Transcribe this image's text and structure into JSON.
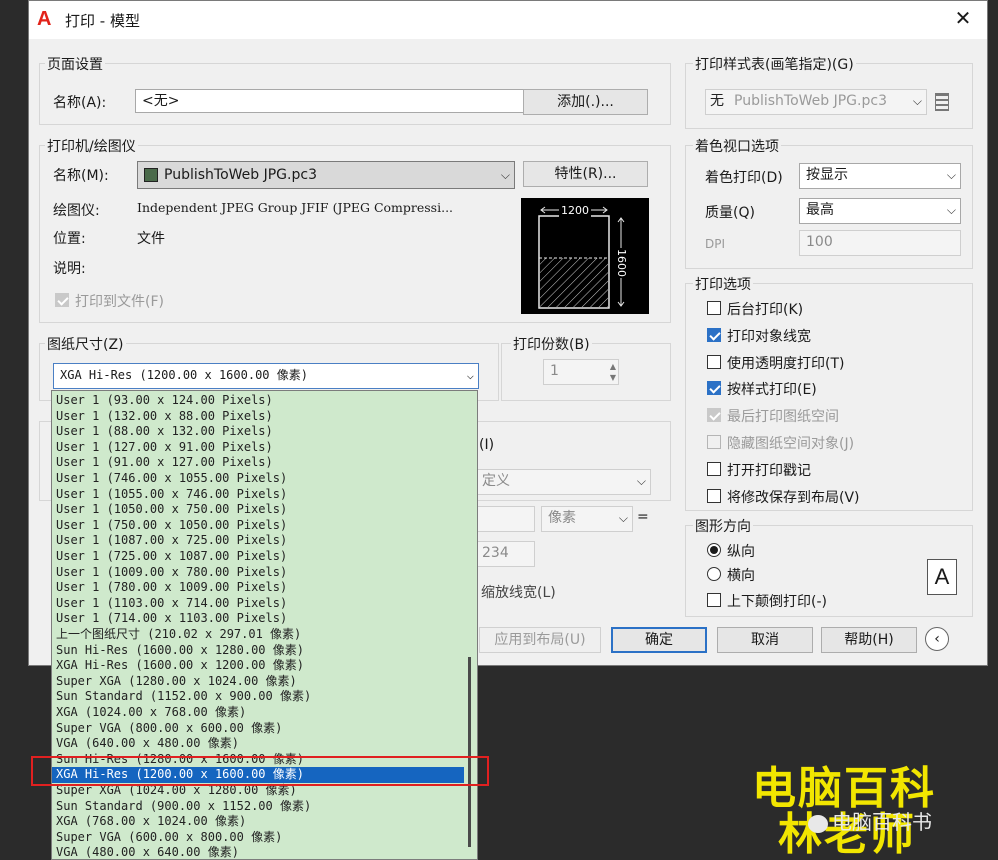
{
  "window": {
    "title": "打印 - 模型",
    "close": "✕"
  },
  "page_setup": {
    "legend": "页面设置",
    "name_label": "名称(A):",
    "name_value": "<无>",
    "add_button": "添加(.)..."
  },
  "printer": {
    "legend": "打印机/绘图仪",
    "name_label": "名称(M):",
    "name_value": "PublishToWeb JPG.pc3",
    "props_button": "特性(R)...",
    "plotter_label": "绘图仪:",
    "plotter_value": "Independent JPEG Group JFIF (JPEG Compressi...",
    "location_label": "位置:",
    "location_value": "文件",
    "desc_label": "说明:",
    "plot_to_file": "打印到文件(F)",
    "preview_width": "1200",
    "preview_height": "1600"
  },
  "paper_size": {
    "legend": "图纸尺寸(Z)",
    "selected": "XGA Hi-Res (1200.00 x 1600.00 像素)",
    "options": [
      "User 1 (93.00 x 124.00 Pixels)",
      "User 1 (132.00 x 88.00 Pixels)",
      "User 1 (88.00 x 132.00 Pixels)",
      "User 1 (127.00 x 91.00 Pixels)",
      "User 1 (91.00 x 127.00 Pixels)",
      "User 1 (746.00 x 1055.00 Pixels)",
      "User 1 (1055.00 x 746.00 Pixels)",
      "User 1 (1050.00 x 750.00 Pixels)",
      "User 1 (750.00 x 1050.00 Pixels)",
      "User 1 (1087.00 x 725.00 Pixels)",
      "User 1 (725.00 x 1087.00 Pixels)",
      "User 1 (1009.00 x 780.00 Pixels)",
      "User 1 (780.00 x 1009.00 Pixels)",
      "User 1 (1103.00 x 714.00 Pixels)",
      "User 1 (714.00 x 1103.00 Pixels)",
      "上一个图纸尺寸 (210.02 x 297.01 像素)",
      "Sun Hi-Res (1600.00 x 1280.00 像素)",
      "XGA Hi-Res (1600.00 x 1200.00 像素)",
      "Super XGA (1280.00 x 1024.00 像素)",
      "Sun Standard (1152.00 x 900.00 像素)",
      "XGA (1024.00 x 768.00 像素)",
      "Super VGA (800.00 x 600.00 像素)",
      "VGA (640.00 x 480.00 像素)",
      "Sun Hi-Res (1280.00 x 1600.00 像素)",
      "XGA Hi-Res (1200.00 x 1600.00 像素)",
      "Super XGA (1024.00 x 1280.00 像素)",
      "Sun Standard (900.00 x 1152.00 像素)",
      "XGA (768.00 x 1024.00 像素)",
      "Super VGA (600.00 x 800.00 像素)",
      "VGA (480.00 x 640.00 像素)"
    ],
    "selected_index": 24
  },
  "copies": {
    "legend": "打印份数(B)",
    "value": "1"
  },
  "partial": {
    "frag1": "(I)",
    "frag2": "定义",
    "frag3": "像素",
    "frag4": "234",
    "frag5": "缩放线宽(L)",
    "apply_button": "应用到布局(U)"
  },
  "plot_style": {
    "legend": "打印样式表(画笔指定)(G)",
    "value": "PublishToWeb JPG.pc3",
    "prefix": "无"
  },
  "shaded": {
    "legend": "着色视口选项",
    "shade_label": "着色打印(D)",
    "shade_value": "按显示",
    "quality_label": "质量(Q)",
    "quality_value": "最高",
    "dpi_label": "DPI",
    "dpi_value": "100"
  },
  "options": {
    "legend": "打印选项",
    "items": [
      {
        "label": "后台打印(K)",
        "checked": false,
        "disabled": false
      },
      {
        "label": "打印对象线宽",
        "checked": true,
        "disabled": false
      },
      {
        "label": "使用透明度打印(T)",
        "checked": false,
        "disabled": false
      },
      {
        "label": "按样式打印(E)",
        "checked": true,
        "disabled": false
      },
      {
        "label": "最后打印图纸空间",
        "checked": true,
        "disabled": true
      },
      {
        "label": "隐藏图纸空间对象(J)",
        "checked": false,
        "disabled": true
      },
      {
        "label": "打开打印戳记",
        "checked": false,
        "disabled": false
      },
      {
        "label": "将修改保存到布局(V)",
        "checked": false,
        "disabled": false
      }
    ]
  },
  "orientation": {
    "legend": "图形方向",
    "portrait": "纵向",
    "landscape": "横向",
    "upside_down": "上下颠倒打印(-)",
    "icon_letter": "A"
  },
  "footer": {
    "ok": "确定",
    "cancel": "取消",
    "help": "帮助(H)"
  },
  "watermark": {
    "line1": "电脑百科",
    "line2": "林老师",
    "account": "电脑百科书"
  }
}
